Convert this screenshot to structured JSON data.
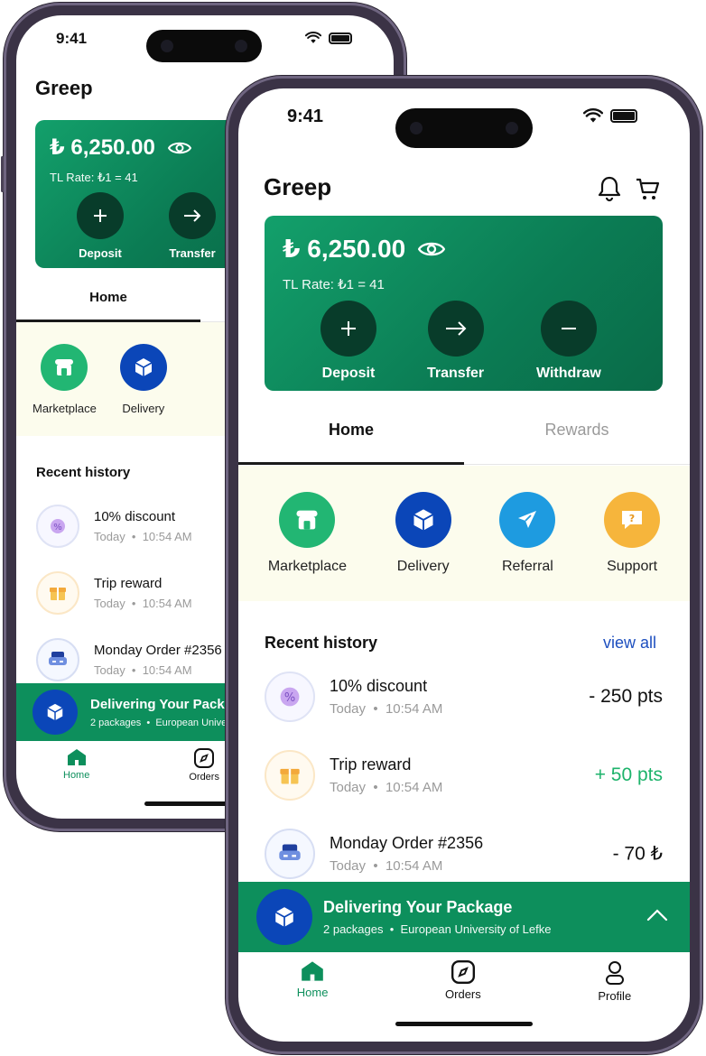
{
  "status": {
    "time": "9:41"
  },
  "app": {
    "brand": "Greep"
  },
  "wallet": {
    "currency_symbol": "₺",
    "amount": "₺ 6,250.00",
    "rate": "TL Rate: ₺1 = 41",
    "actions": [
      {
        "label": "Deposit",
        "icon": "plus-icon"
      },
      {
        "label": "Transfer",
        "icon": "arrow-right-icon"
      },
      {
        "label": "Withdraw",
        "icon": "minus-icon"
      }
    ]
  },
  "tabs": [
    {
      "label": "Home",
      "active": true
    },
    {
      "label": "Rewards",
      "active": false
    }
  ],
  "services": [
    {
      "label": "Marketplace",
      "icon": "storefront-icon",
      "color": "#22b673"
    },
    {
      "label": "Delivery",
      "icon": "box-icon",
      "color": "#0b46b8"
    },
    {
      "label": "Referral",
      "icon": "paper-plane-icon",
      "color": "#1e9be0"
    },
    {
      "label": "Support",
      "icon": "chat-question-icon",
      "color": "#f6b53c"
    }
  ],
  "history": {
    "title": "Recent history",
    "view_all": "view all",
    "items": [
      {
        "title": "10% discount",
        "date": "Today",
        "time": "10:54 AM",
        "amount": "- 250 pts",
        "tone": "neutral",
        "icon": "discount-badge-icon"
      },
      {
        "title": "Trip reward",
        "date": "Today",
        "time": "10:54 AM",
        "amount": "+ 50 pts",
        "tone": "positive",
        "icon": "gift-icon"
      },
      {
        "title": "Monday Order #2356",
        "date": "Today",
        "time": "10:54 AM",
        "amount": "- 70 ₺",
        "tone": "neutral",
        "icon": "car-icon"
      }
    ]
  },
  "delivery_banner": {
    "title": "Delivering Your Package",
    "packages": "2 packages",
    "location": "European University of Lefke"
  },
  "nav": [
    {
      "label": "Home",
      "icon": "home-icon",
      "active": true
    },
    {
      "label": "Orders",
      "icon": "compass-icon",
      "active": false
    },
    {
      "label": "Profile",
      "icon": "profile-icon",
      "active": false
    }
  ],
  "colors": {
    "brand_green": "#0d8f5c",
    "accent_blue": "#0b46b8",
    "positive": "#1db36b",
    "link": "#1d4fbf"
  }
}
